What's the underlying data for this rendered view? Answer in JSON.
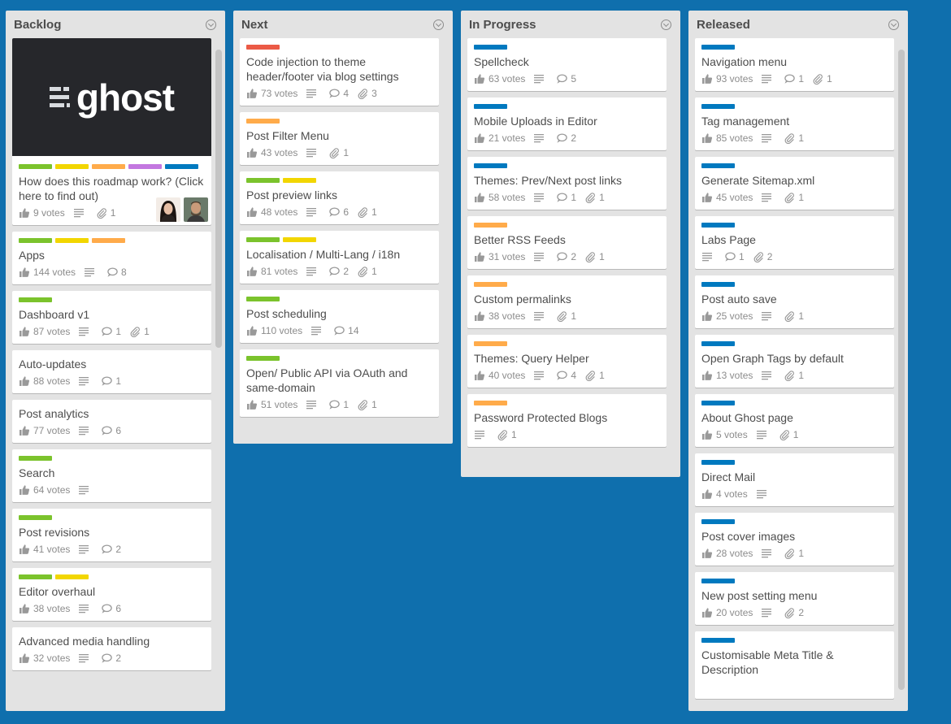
{
  "colors": {
    "background": "#0f6fad",
    "green": "#7bc32c",
    "yellow": "#f2d600",
    "orange": "#ffab4a",
    "red": "#eb5a46",
    "purple": "#c377e0",
    "blue": "#0079bf"
  },
  "lists": [
    {
      "title": "Backlog",
      "cards": [
        {
          "cover": "ghost",
          "cover_text": "ghost",
          "labels": [
            "green",
            "yellow",
            "orange",
            "purple",
            "blue"
          ],
          "title": "How does this roadmap work? (Click here to find out)",
          "votes": "9 votes",
          "description": true,
          "comments": null,
          "attachments": "1",
          "avatars": true
        },
        {
          "labels": [
            "green",
            "yellow",
            "orange"
          ],
          "title": "Apps",
          "votes": "144 votes",
          "description": true,
          "comments": "8",
          "attachments": null
        },
        {
          "labels": [
            "green"
          ],
          "title": "Dashboard v1",
          "votes": "87 votes",
          "description": true,
          "comments": "1",
          "attachments": "1"
        },
        {
          "labels": [],
          "title": "Auto-updates",
          "votes": "88 votes",
          "description": true,
          "comments": "1",
          "attachments": null
        },
        {
          "labels": [],
          "title": "Post analytics",
          "votes": "77 votes",
          "description": true,
          "comments": "6",
          "attachments": null
        },
        {
          "labels": [
            "green"
          ],
          "title": "Search",
          "votes": "64 votes",
          "description": true,
          "comments": null,
          "attachments": null
        },
        {
          "labels": [
            "green"
          ],
          "title": "Post revisions",
          "votes": "41 votes",
          "description": true,
          "comments": "2",
          "attachments": null
        },
        {
          "labels": [
            "green",
            "yellow"
          ],
          "title": "Editor overhaul",
          "votes": "38 votes",
          "description": true,
          "comments": "6",
          "attachments": null
        },
        {
          "labels": [],
          "title": "Advanced media handling",
          "votes": "32 votes",
          "description": true,
          "comments": "2",
          "attachments": null
        }
      ]
    },
    {
      "title": "Next",
      "cards": [
        {
          "labels": [
            "red"
          ],
          "title": "Code injection to theme header/footer via blog settings",
          "votes": "73 votes",
          "description": true,
          "comments": "4",
          "attachments": "3"
        },
        {
          "labels": [
            "orange"
          ],
          "title": "Post Filter Menu",
          "votes": "43 votes",
          "description": true,
          "comments": null,
          "attachments": "1"
        },
        {
          "labels": [
            "green",
            "yellow"
          ],
          "title": "Post preview links",
          "votes": "48 votes",
          "description": true,
          "comments": "6",
          "attachments": "1"
        },
        {
          "labels": [
            "green",
            "yellow"
          ],
          "title": "Localisation / Multi-Lang / i18n",
          "votes": "81 votes",
          "description": true,
          "comments": "2",
          "attachments": "1"
        },
        {
          "labels": [
            "green"
          ],
          "title": "Post scheduling",
          "votes": "110 votes",
          "description": true,
          "comments": "14",
          "attachments": null
        },
        {
          "labels": [
            "green"
          ],
          "title": "Open/ Public API via OAuth and same-domain",
          "votes": "51 votes",
          "description": true,
          "comments": "1",
          "attachments": "1"
        }
      ]
    },
    {
      "title": "In Progress",
      "cards": [
        {
          "labels": [
            "blue"
          ],
          "title": "Spellcheck",
          "votes": "63 votes",
          "description": true,
          "comments": "5",
          "attachments": null
        },
        {
          "labels": [
            "blue"
          ],
          "title": "Mobile Uploads in Editor",
          "votes": "21 votes",
          "description": true,
          "comments": "2",
          "attachments": null
        },
        {
          "labels": [
            "blue"
          ],
          "title": "Themes: Prev/Next post links",
          "votes": "58 votes",
          "description": true,
          "comments": "1",
          "attachments": "1"
        },
        {
          "labels": [
            "orange"
          ],
          "title": "Better RSS Feeds",
          "votes": "31 votes",
          "description": true,
          "comments": "2",
          "attachments": "1"
        },
        {
          "labels": [
            "orange"
          ],
          "title": "Custom permalinks",
          "votes": "38 votes",
          "description": true,
          "comments": null,
          "attachments": "1"
        },
        {
          "labels": [
            "orange"
          ],
          "title": "Themes: Query Helper",
          "votes": "40 votes",
          "description": true,
          "comments": "4",
          "attachments": "1"
        },
        {
          "labels": [
            "orange"
          ],
          "title": "Password Protected Blogs",
          "votes": null,
          "description": true,
          "comments": null,
          "attachments": "1"
        }
      ]
    },
    {
      "title": "Released",
      "cards": [
        {
          "labels": [
            "blue"
          ],
          "title": "Navigation menu",
          "votes": "93 votes",
          "description": true,
          "comments": "1",
          "attachments": "1"
        },
        {
          "labels": [
            "blue"
          ],
          "title": "Tag management",
          "votes": "85 votes",
          "description": true,
          "comments": null,
          "attachments": "1"
        },
        {
          "labels": [
            "blue"
          ],
          "title": "Generate Sitemap.xml",
          "votes": "45 votes",
          "description": true,
          "comments": null,
          "attachments": "1"
        },
        {
          "labels": [
            "blue"
          ],
          "title": "Labs Page",
          "votes": null,
          "description": true,
          "comments": "1",
          "attachments": "2"
        },
        {
          "labels": [
            "blue"
          ],
          "title": "Post auto save",
          "votes": "25 votes",
          "description": true,
          "comments": null,
          "attachments": "1"
        },
        {
          "labels": [
            "blue"
          ],
          "title": "Open Graph Tags by default",
          "votes": "13 votes",
          "description": true,
          "comments": null,
          "attachments": "1"
        },
        {
          "labels": [
            "blue"
          ],
          "title": "About Ghost page",
          "votes": "5 votes",
          "description": true,
          "comments": null,
          "attachments": "1"
        },
        {
          "labels": [
            "blue"
          ],
          "title": "Direct Mail",
          "votes": "4 votes",
          "description": true,
          "comments": null,
          "attachments": null
        },
        {
          "labels": [
            "blue"
          ],
          "title": "Post cover images",
          "votes": "28 votes",
          "description": true,
          "comments": null,
          "attachments": "1"
        },
        {
          "labels": [
            "blue"
          ],
          "title": "New post setting menu",
          "votes": "20 votes",
          "description": true,
          "comments": null,
          "attachments": "2"
        },
        {
          "labels": [
            "blue"
          ],
          "title": "Customisable Meta Title & Description",
          "votes": null,
          "description": false,
          "comments": null,
          "attachments": null
        }
      ]
    }
  ]
}
